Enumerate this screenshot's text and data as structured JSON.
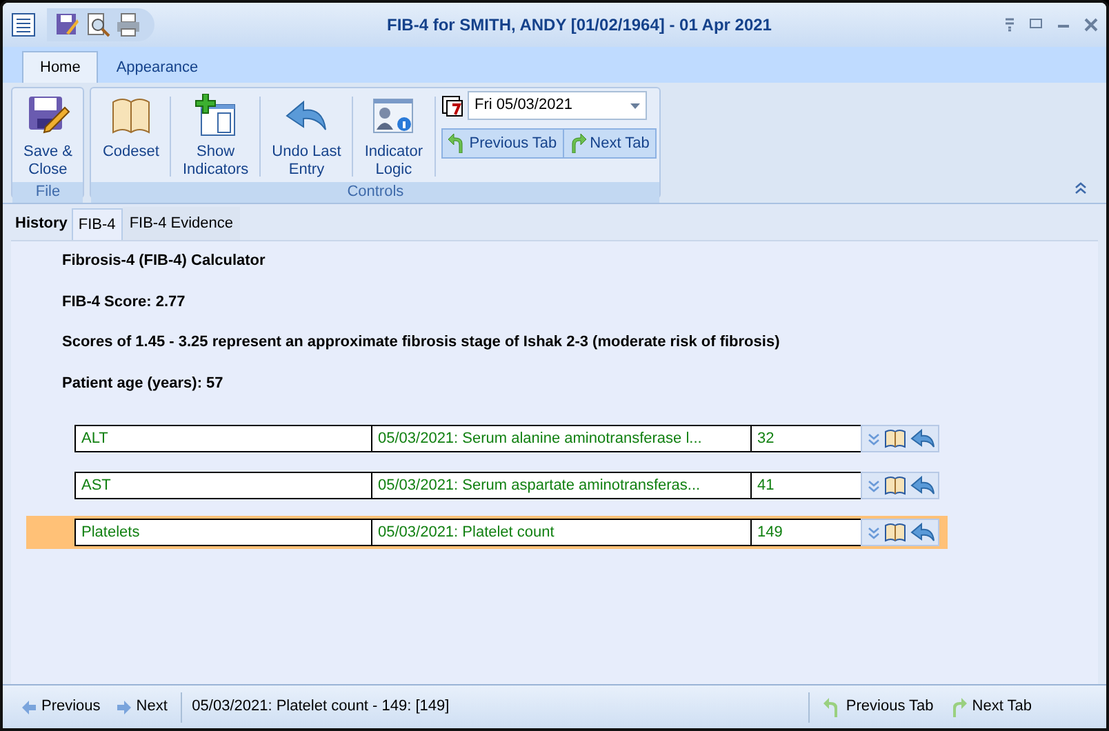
{
  "window": {
    "title": "FIB-4 for SMITH, ANDY [01/02/1964] - 01 Apr 2021"
  },
  "ribbon_tabs": [
    {
      "label": "Home",
      "selected": true
    },
    {
      "label": "Appearance",
      "selected": false
    }
  ],
  "ribbon_groups": [
    {
      "label": "File",
      "buttons": [
        {
          "kind": "save",
          "label": "Save &\nClose"
        }
      ]
    },
    {
      "label": "Controls",
      "buttons": [
        {
          "kind": "book",
          "label": "Codeset"
        },
        {
          "kind": "indicators",
          "label": "Show\nIndicators"
        },
        {
          "kind": "undo",
          "label": "Undo Last\nEntry"
        },
        {
          "kind": "logic",
          "label": "Indicator\nLogic"
        }
      ],
      "date": "Fri 05/03/2021",
      "nav": [
        "Previous Tab",
        "Next Tab"
      ]
    }
  ],
  "doc_tabs": [
    {
      "kind": "label",
      "label": "History",
      "selected": false
    },
    {
      "kind": "tab",
      "label": "FIB-4",
      "selected": true
    },
    {
      "kind": "tab",
      "label": "FIB-4 Evidence",
      "selected": false
    }
  ],
  "content": {
    "lines": [
      "Fibrosis-4 (FIB-4) Calculator",
      "FIB-4 Score: 2.77",
      "Scores of 1.45 - 3.25 represent an approximate fibrosis stage of Ishak 2-3 (moderate risk of fibrosis)",
      "Patient age (years): 57"
    ],
    "rows": [
      {
        "name": "ALT",
        "result": "05/03/2021: Serum alanine aminotransferase l...",
        "value": "32",
        "selected": false
      },
      {
        "name": "AST",
        "result": "05/03/2021: Serum aspartate aminotransferas...",
        "value": "41",
        "selected": false
      },
      {
        "name": "Platelets",
        "result": "05/03/2021: Platelet count",
        "value": "149",
        "selected": true
      }
    ]
  },
  "status_bar": {
    "nav": [
      "Previous",
      "Next"
    ],
    "text": "05/03/2021: Platelet count - 149: [149]",
    "tabs": [
      "Previous Tab",
      "Next Tab"
    ]
  }
}
